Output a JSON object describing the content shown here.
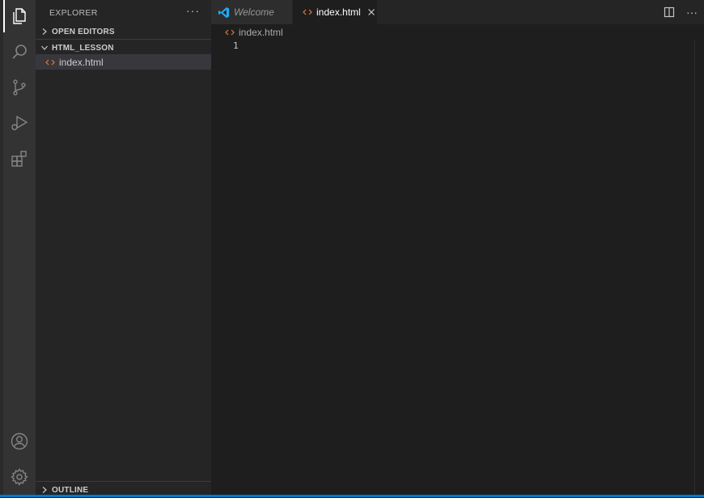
{
  "sidebar": {
    "title": "EXPLORER",
    "more": "···",
    "sections": {
      "open_editors": "OPEN EDITORS",
      "folder": "HTML_LESSON",
      "outline": "OUTLINE"
    },
    "files": [
      {
        "name": "index.html",
        "icon": "html-file-icon"
      }
    ]
  },
  "tabs": [
    {
      "label": "Welcome",
      "icon": "vscode-logo-icon",
      "active": false
    },
    {
      "label": "index.html",
      "icon": "html-file-icon",
      "active": true
    }
  ],
  "tab_actions": {
    "more": "···"
  },
  "breadcrumb": {
    "file": "index.html"
  },
  "editor": {
    "line_numbers": [
      "1"
    ]
  },
  "activity_bar": [
    "explorer-icon",
    "search-icon",
    "source-control-icon",
    "run-debug-icon",
    "extensions-icon",
    "account-icon",
    "settings-gear-icon"
  ],
  "colors": {
    "accent": "#007acc",
    "html_icon": "#e37933",
    "vscode_blue": "#23a9f2"
  }
}
